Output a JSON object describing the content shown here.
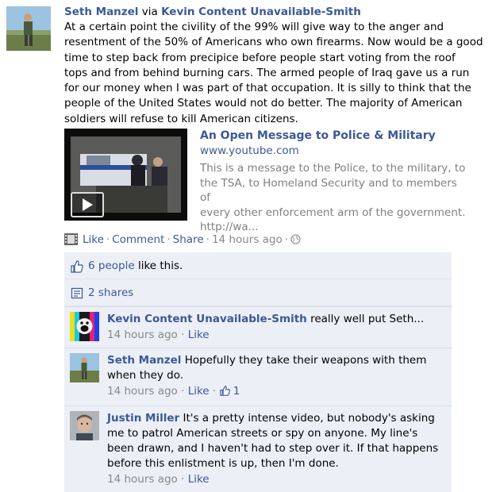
{
  "post": {
    "author": "Seth Manzel",
    "via_text": "via",
    "via_author": "Kevin Content Unavailable-Smith",
    "message_lines": [
      "At a certain point the civility of the 99% will give way to the anger and",
      "resentment of the 50% of Americans who own firearms. Now would be a good",
      "time to step back from precipice before people start voting from the roof",
      "tops and from behind burning cars. The armed people of Iraq gave us a run",
      "for our money when I was part of that occupation. It is silly to think that the",
      "people of the United States would not do better. The majority of American",
      "soldiers will refuse to kill American citizens."
    ],
    "attachment": {
      "title": "An Open Message to Police & Military",
      "url": "www.youtube.com",
      "description_lines": [
        "This is a message to the Police, to the military, to",
        "the TSA, to Homeland Security and to members of",
        "every other enforcement arm of the government.",
        "http://wa..."
      ]
    },
    "actions": {
      "like": "Like",
      "comment": "Comment",
      "share": "Share",
      "time": "14 hours ago"
    }
  },
  "ufi": {
    "likes_link": "6 people",
    "likes_suffix": "like this.",
    "shares": "2 shares"
  },
  "comments": [
    {
      "author": "Kevin Content Unavailable-Smith",
      "text": "really well put Seth...",
      "time": "14 hours ago",
      "like": "Like"
    },
    {
      "author": "Seth Manzel",
      "text_line1": "Hopefully they take their weapons with them",
      "text_line2": "when they do.",
      "time": "14 hours ago",
      "like": "Like",
      "like_count": "1"
    },
    {
      "author": "Justin Miller",
      "text_line1": "It's a pretty intense video, but nobody's asking",
      "text_lines": [
        "me to patrol American streets or spy on anyone. My line's",
        "been drawn, and I haven't had to step over it. If that happens",
        "before this enlistment is up, then I'm done."
      ],
      "time": "14 hours ago",
      "like": "Like"
    }
  ],
  "colors": {
    "link": "#3b5998",
    "ufi_bg": "#eceff5",
    "meta": "#888888"
  }
}
